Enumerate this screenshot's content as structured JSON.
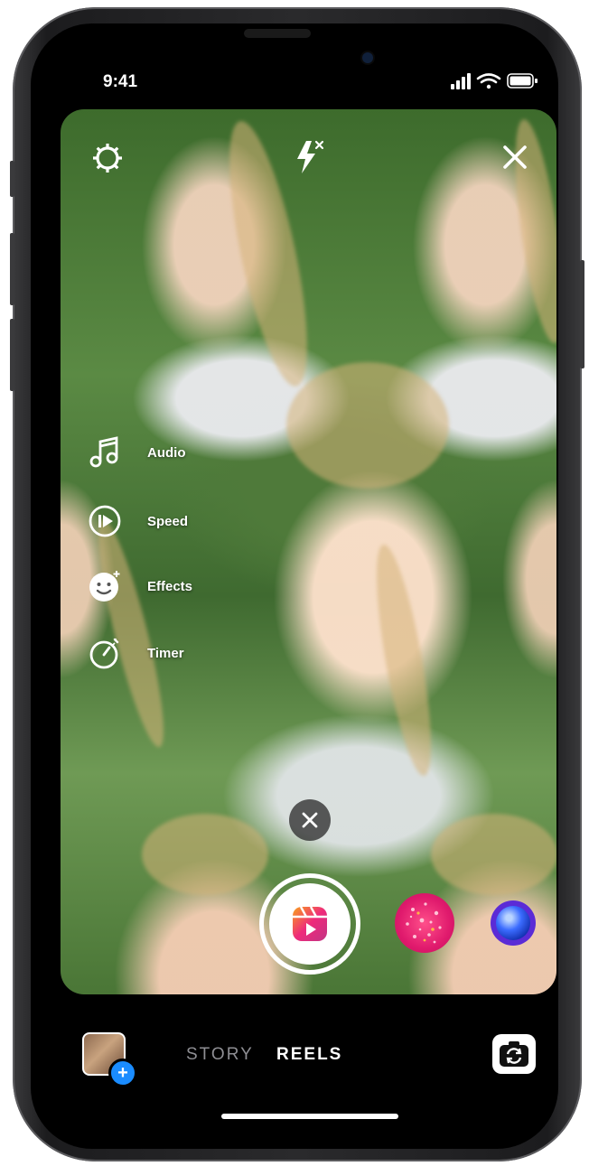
{
  "status_bar": {
    "time": "9:41"
  },
  "top_controls": {
    "settings_icon": "gear-icon",
    "flash_icon": "flash-off-icon",
    "close_icon": "close-icon"
  },
  "tools": [
    {
      "label": "Audio",
      "icon": "music-note-icon"
    },
    {
      "label": "Speed",
      "icon": "speed-icon"
    },
    {
      "label": "Effects",
      "icon": "effects-face-icon"
    },
    {
      "label": "Timer",
      "icon": "timer-icon"
    }
  ],
  "capture": {
    "icon": "reels-icon"
  },
  "modes": {
    "story": "STORY",
    "reels": "REELS"
  },
  "colors": {
    "accent_blue": "#1a8cff",
    "effect_pink": "#e01a6d",
    "effect_purple": "#5b2bd6"
  }
}
